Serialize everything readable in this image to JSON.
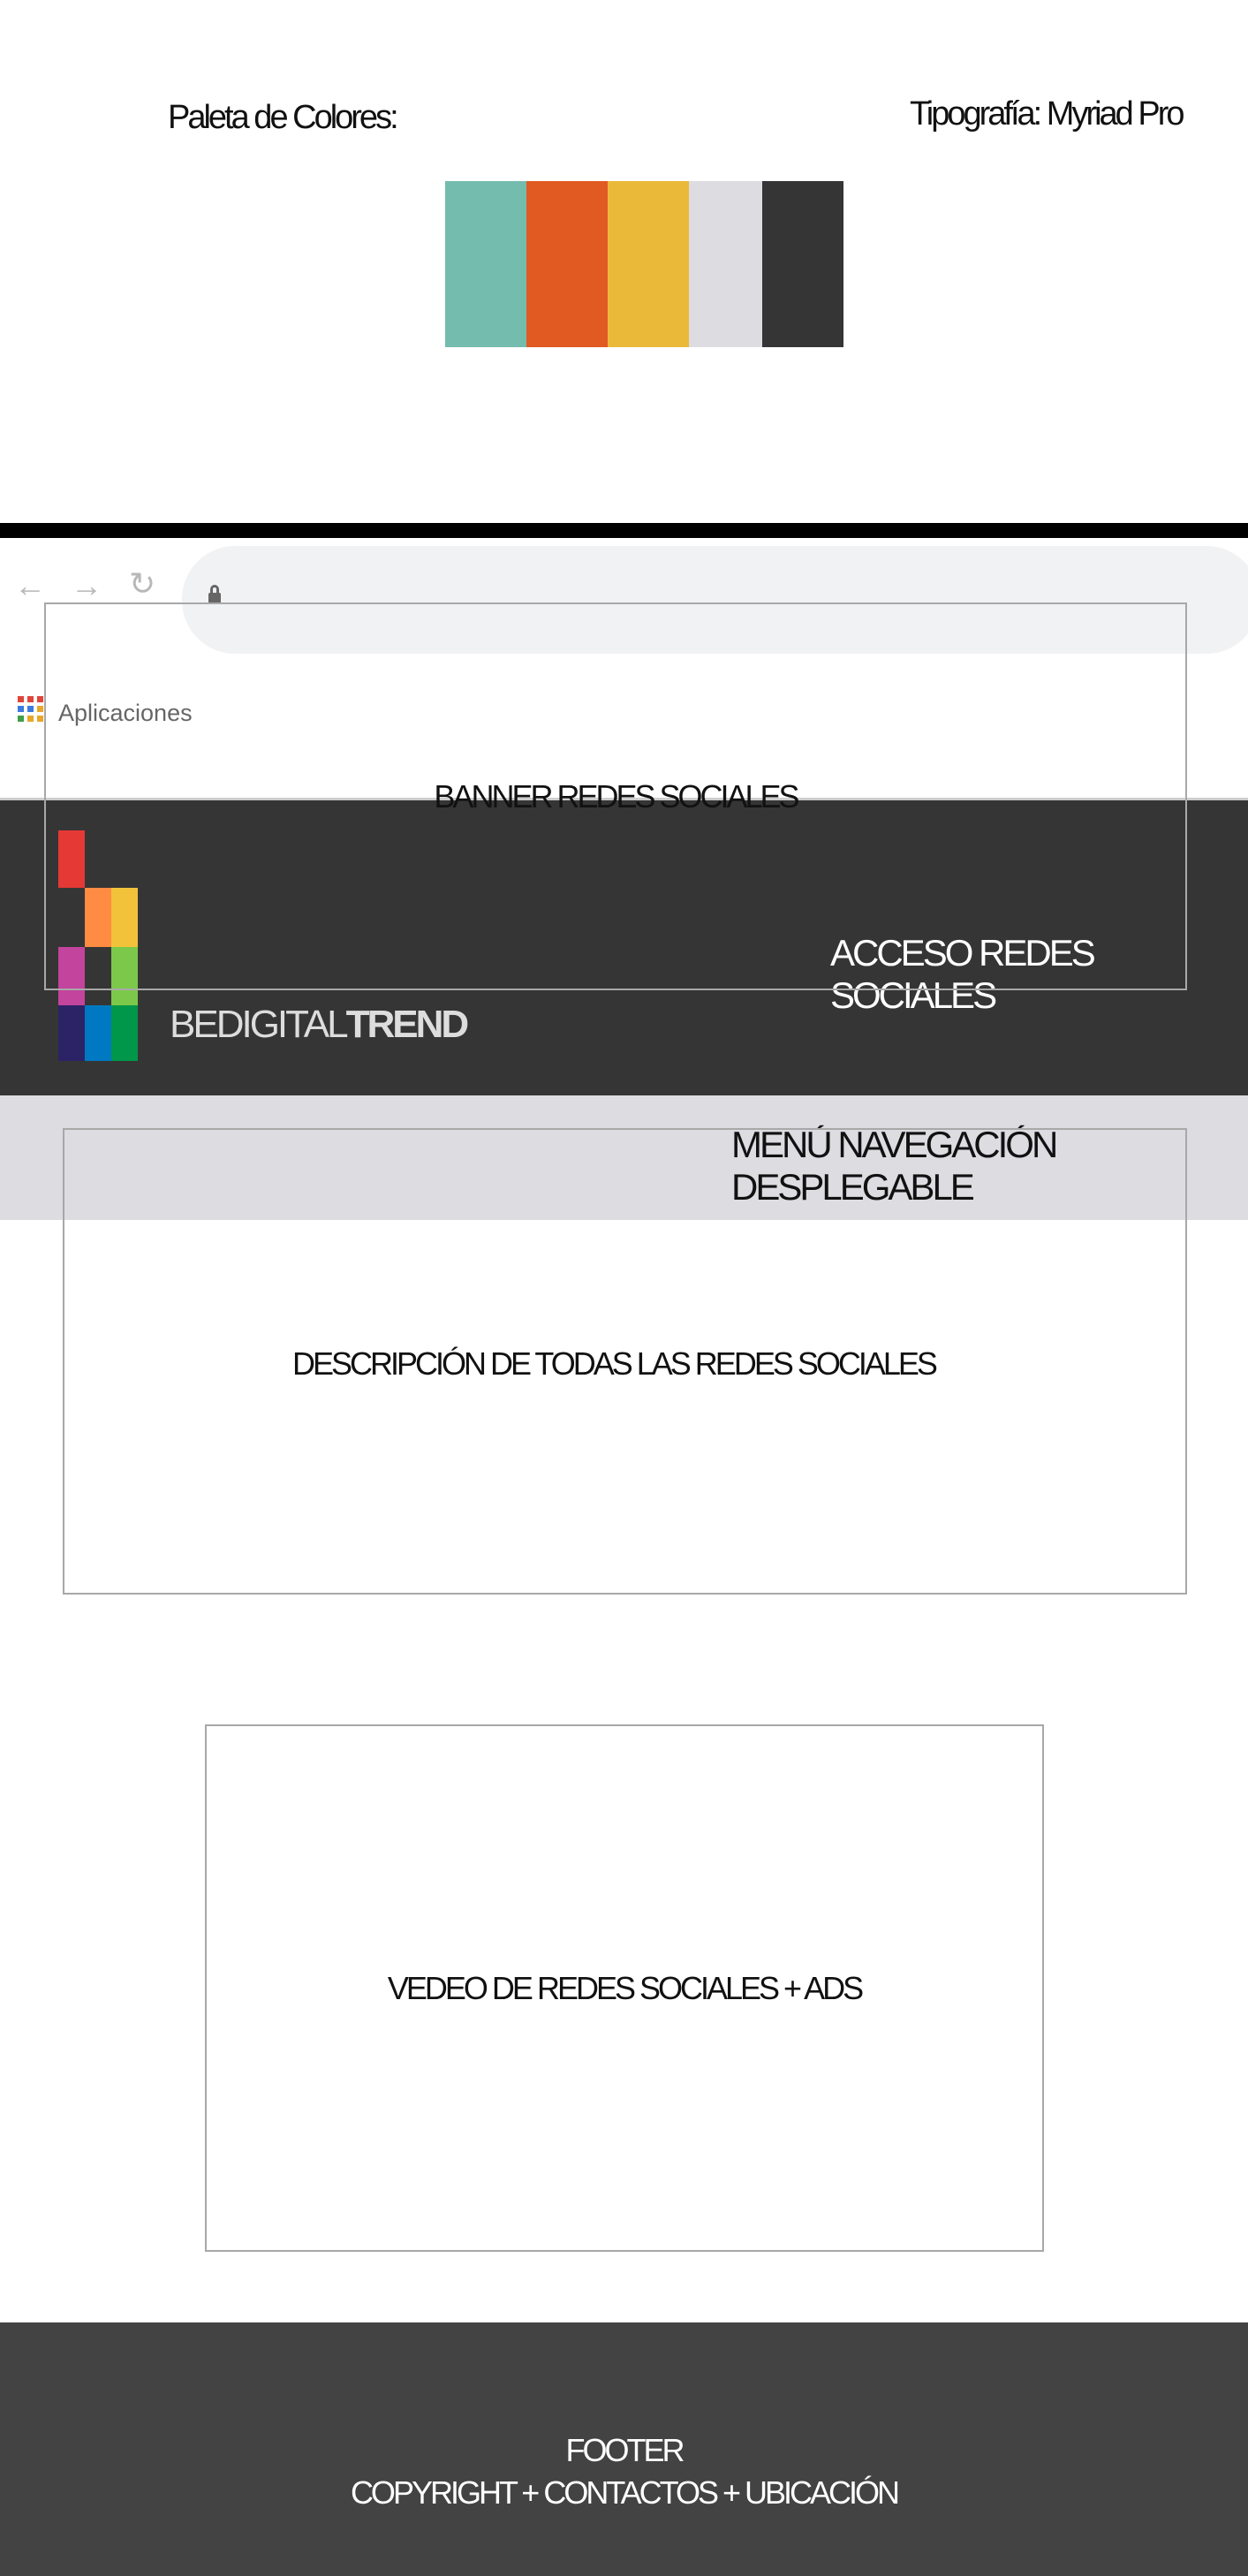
{
  "style_guide": {
    "palette_label": "Paleta de Colores:",
    "palette": [
      "#74bcae",
      "#e05a22",
      "#ebb93a",
      "#dcdce1",
      "#353535"
    ],
    "typography_label": "Tipografía: Myriad Pro"
  },
  "browser": {
    "back_icon": "←",
    "forward_icon": "→",
    "reload_icon": "↻",
    "bookmark_apps": "Aplicaciones"
  },
  "header": {
    "brand_light": "BEDIGITAL",
    "brand_bold": "TREND",
    "social_access": "ACCESO REDES SOCIALES",
    "logo_colors": [
      "#e53935",
      "#ff8c42",
      "#f2c23a",
      "#c2449c",
      "#7cc84a",
      "#2c2366",
      "#0079c2",
      "#00974a"
    ]
  },
  "nav": {
    "menu": "MENÚ NAVEGACIÓN DESPLEGABLE"
  },
  "sections": {
    "banner": "BANNER REDES SOCIALES",
    "description": "DESCRIPCIÓN DE TODAS LAS REDES SOCIALES",
    "video": "VEDEO DE REDES SOCIALES + ADS"
  },
  "footer": {
    "line1": "FOOTER",
    "line2": "COPYRIGHT + CONTACTOS + UBICACIÓN"
  }
}
